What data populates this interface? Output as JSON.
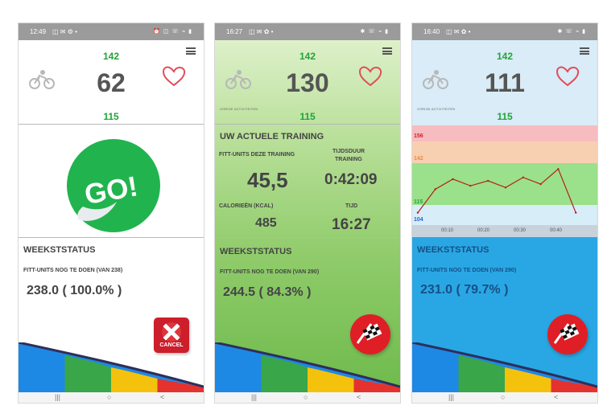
{
  "phones": [
    {
      "status_time": "12:49",
      "status_icons": "◫ ✉ ⚙ •",
      "status_right": "⏰ ◫ ☏ ⌁ ▮",
      "hr_top": "142",
      "hr_main": "62",
      "hr_bottom": "115",
      "go_text": "GO!",
      "week_title": "WEEKSTSTATUS",
      "fitt_units_label": "FITT-UNITS NOG TE DOEN (VAN 238)",
      "fitt_units_value": "238.0 ( 100.0% )",
      "cancel_label": "CANCEL"
    },
    {
      "status_time": "16:27",
      "status_icons": "◫ ✉ ✿ •",
      "status_right": "✱ ☏ ⌁ ▮",
      "hr_top": "142",
      "hr_main": "130",
      "hr_bottom": "115",
      "activity_label": "VORIGE ACTIVITEITEN",
      "training_title": "UW ACTUELE TRAINING",
      "fitt_training_label": "FITT-UNITS DEZE TRAINING",
      "fitt_training_value": "45,5",
      "duration_label_1": "TIJDSDUUR",
      "duration_label_2": "TRAINING",
      "duration_value": "0:42:09",
      "calories_label": "CALORIEËN (KCAL)",
      "calories_value": "485",
      "time_label": "TIJD",
      "time_value": "16:27",
      "week_title": "WEEKSTSTATUS",
      "fitt_units_label": "FITT-UNITS NOG TE DOEN (VAN 290)",
      "fitt_units_value": "244.5 ( 84.3% )"
    },
    {
      "status_time": "16:40",
      "status_icons": "◫ ✉ ✿ •",
      "status_right": "✱ ☏ ⌁ ▮",
      "hr_top": "142",
      "hr_main": "111",
      "hr_bottom": "115",
      "activity_label": "VORIGE ACTIVITEITEN",
      "graph_thresholds": [
        "156",
        "142",
        "115",
        "104"
      ],
      "graph_times": [
        "00:10",
        "00:20",
        "00:30",
        "00:40"
      ],
      "week_title": "WEEKSTSTATUS",
      "fitt_units_label": "FITT-UNITS NOG TE DOEN (VAN 290)",
      "fitt_units_value": "231.0 ( 79.7% )"
    }
  ],
  "navigation": {
    "recent": "|||",
    "home": "○",
    "back": "<"
  },
  "colors": {
    "green": "#22a43a",
    "red": "#e01e26",
    "blue": "#29a7e4",
    "gray": "#555555"
  },
  "chart_data": {
    "type": "line",
    "x": [
      "00:00",
      "00:05",
      "00:10",
      "00:15",
      "00:20",
      "00:25",
      "00:30",
      "00:35",
      "00:40",
      "00:45"
    ],
    "series": [
      {
        "values": [
          112,
          126,
          132,
          128,
          131,
          127,
          133,
          129,
          138,
          112
        ]
      }
    ],
    "ylim": [
      96,
      164
    ],
    "threshold_lines": [
      156,
      142,
      115,
      104
    ],
    "grid": false
  }
}
